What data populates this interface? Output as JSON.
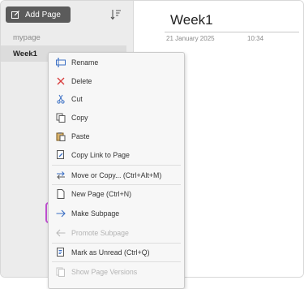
{
  "sidebar": {
    "add_page_label": "Add Page",
    "pages": [
      {
        "label": "mypage"
      },
      {
        "label": "Week1"
      }
    ]
  },
  "page": {
    "title": "Week1",
    "date": "21 January 2025",
    "time": "10:34"
  },
  "context_menu": {
    "items": [
      {
        "label": "Rename",
        "icon": "rename-icon",
        "enabled": true
      },
      {
        "label": "Delete",
        "icon": "delete-x-icon",
        "enabled": true
      },
      {
        "label": "Cut",
        "icon": "scissors-icon",
        "enabled": true
      },
      {
        "label": "Copy",
        "icon": "copy-icon",
        "enabled": true
      },
      {
        "label": "Paste",
        "icon": "paste-icon",
        "enabled": true
      },
      {
        "label": "Copy Link to Page",
        "icon": "link-page-icon",
        "enabled": true
      },
      {
        "label": "Move or Copy... (Ctrl+Alt+M)",
        "icon": "move-icon",
        "enabled": true
      },
      {
        "label": "New Page (Ctrl+N)",
        "icon": "new-page-icon",
        "enabled": true
      },
      {
        "label": "Make Subpage",
        "icon": "arrow-right-icon",
        "enabled": true,
        "highlighted": true
      },
      {
        "label": "Promote Subpage",
        "icon": "arrow-left-icon",
        "enabled": false
      },
      {
        "label": "Mark as Unread (Ctrl+Q)",
        "icon": "mark-unread-icon",
        "enabled": true
      },
      {
        "label": "Show Page Versions",
        "icon": "page-versions-icon",
        "enabled": false
      }
    ]
  },
  "colors": {
    "highlight_border": "#c14fd2",
    "accent_icon": "#3b6fc4",
    "delete_icon": "#d83b3b"
  }
}
